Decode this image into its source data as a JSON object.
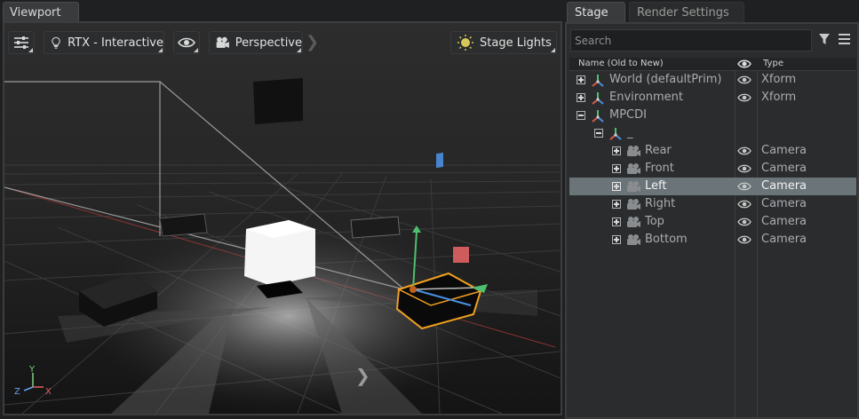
{
  "viewport": {
    "tab_label": "Viewport",
    "toolbar": {
      "renderer_label": "RTX - Interactive",
      "camera_label": "Perspective",
      "lights_label": "Stage Lights"
    },
    "axes": {
      "y": "Y",
      "z": "Z",
      "x": "X"
    },
    "icons": [
      "settings-sliders-icon",
      "lightbulb-icon",
      "eye-icon",
      "camera-icon",
      "sun-icon",
      "chevron-right-icon"
    ]
  },
  "stage": {
    "tabs": [
      "Stage",
      "Render Settings"
    ],
    "search_placeholder": "Search",
    "columns": {
      "name": "Name (Old to New)",
      "type": "Type"
    },
    "rows": [
      {
        "name": "World (defaultPrim)",
        "type": "Xform",
        "icon": "xform-icon",
        "expanded": false,
        "depth": 0,
        "visible_toggle": true,
        "selected": false
      },
      {
        "name": "Environment",
        "type": "Xform",
        "icon": "xform-icon",
        "expanded": false,
        "depth": 0,
        "visible_toggle": true,
        "selected": false
      },
      {
        "name": "MPCDI",
        "type": "",
        "icon": "xform-icon",
        "expanded": true,
        "depth": 0,
        "visible_toggle": false,
        "selected": false
      },
      {
        "name": "_",
        "type": "",
        "icon": "xform-icon",
        "expanded": true,
        "depth": 1,
        "visible_toggle": false,
        "selected": false
      },
      {
        "name": "Rear",
        "type": "Camera",
        "icon": "camera-icon",
        "expanded": false,
        "depth": 2,
        "visible_toggle": true,
        "selected": false
      },
      {
        "name": "Front",
        "type": "Camera",
        "icon": "camera-icon",
        "expanded": false,
        "depth": 2,
        "visible_toggle": true,
        "selected": false
      },
      {
        "name": "Left",
        "type": "Camera",
        "icon": "camera-icon",
        "expanded": false,
        "depth": 2,
        "visible_toggle": true,
        "selected": true
      },
      {
        "name": "Right",
        "type": "Camera",
        "icon": "camera-icon",
        "expanded": false,
        "depth": 2,
        "visible_toggle": true,
        "selected": false
      },
      {
        "name": "Top",
        "type": "Camera",
        "icon": "camera-icon",
        "expanded": false,
        "depth": 2,
        "visible_toggle": true,
        "selected": false
      },
      {
        "name": "Bottom",
        "type": "Camera",
        "icon": "camera-icon",
        "expanded": false,
        "depth": 2,
        "visible_toggle": true,
        "selected": false
      }
    ]
  },
  "colors": {
    "selection": "#6a7479",
    "gizmo_highlight": "#f0a020",
    "xform_red": "#d85a4a",
    "xform_green": "#4fbf6f",
    "xform_blue": "#4a8fe0",
    "axis_x": "#e06060",
    "axis_y": "#7fd07f",
    "axis_z": "#6a9fe8"
  }
}
